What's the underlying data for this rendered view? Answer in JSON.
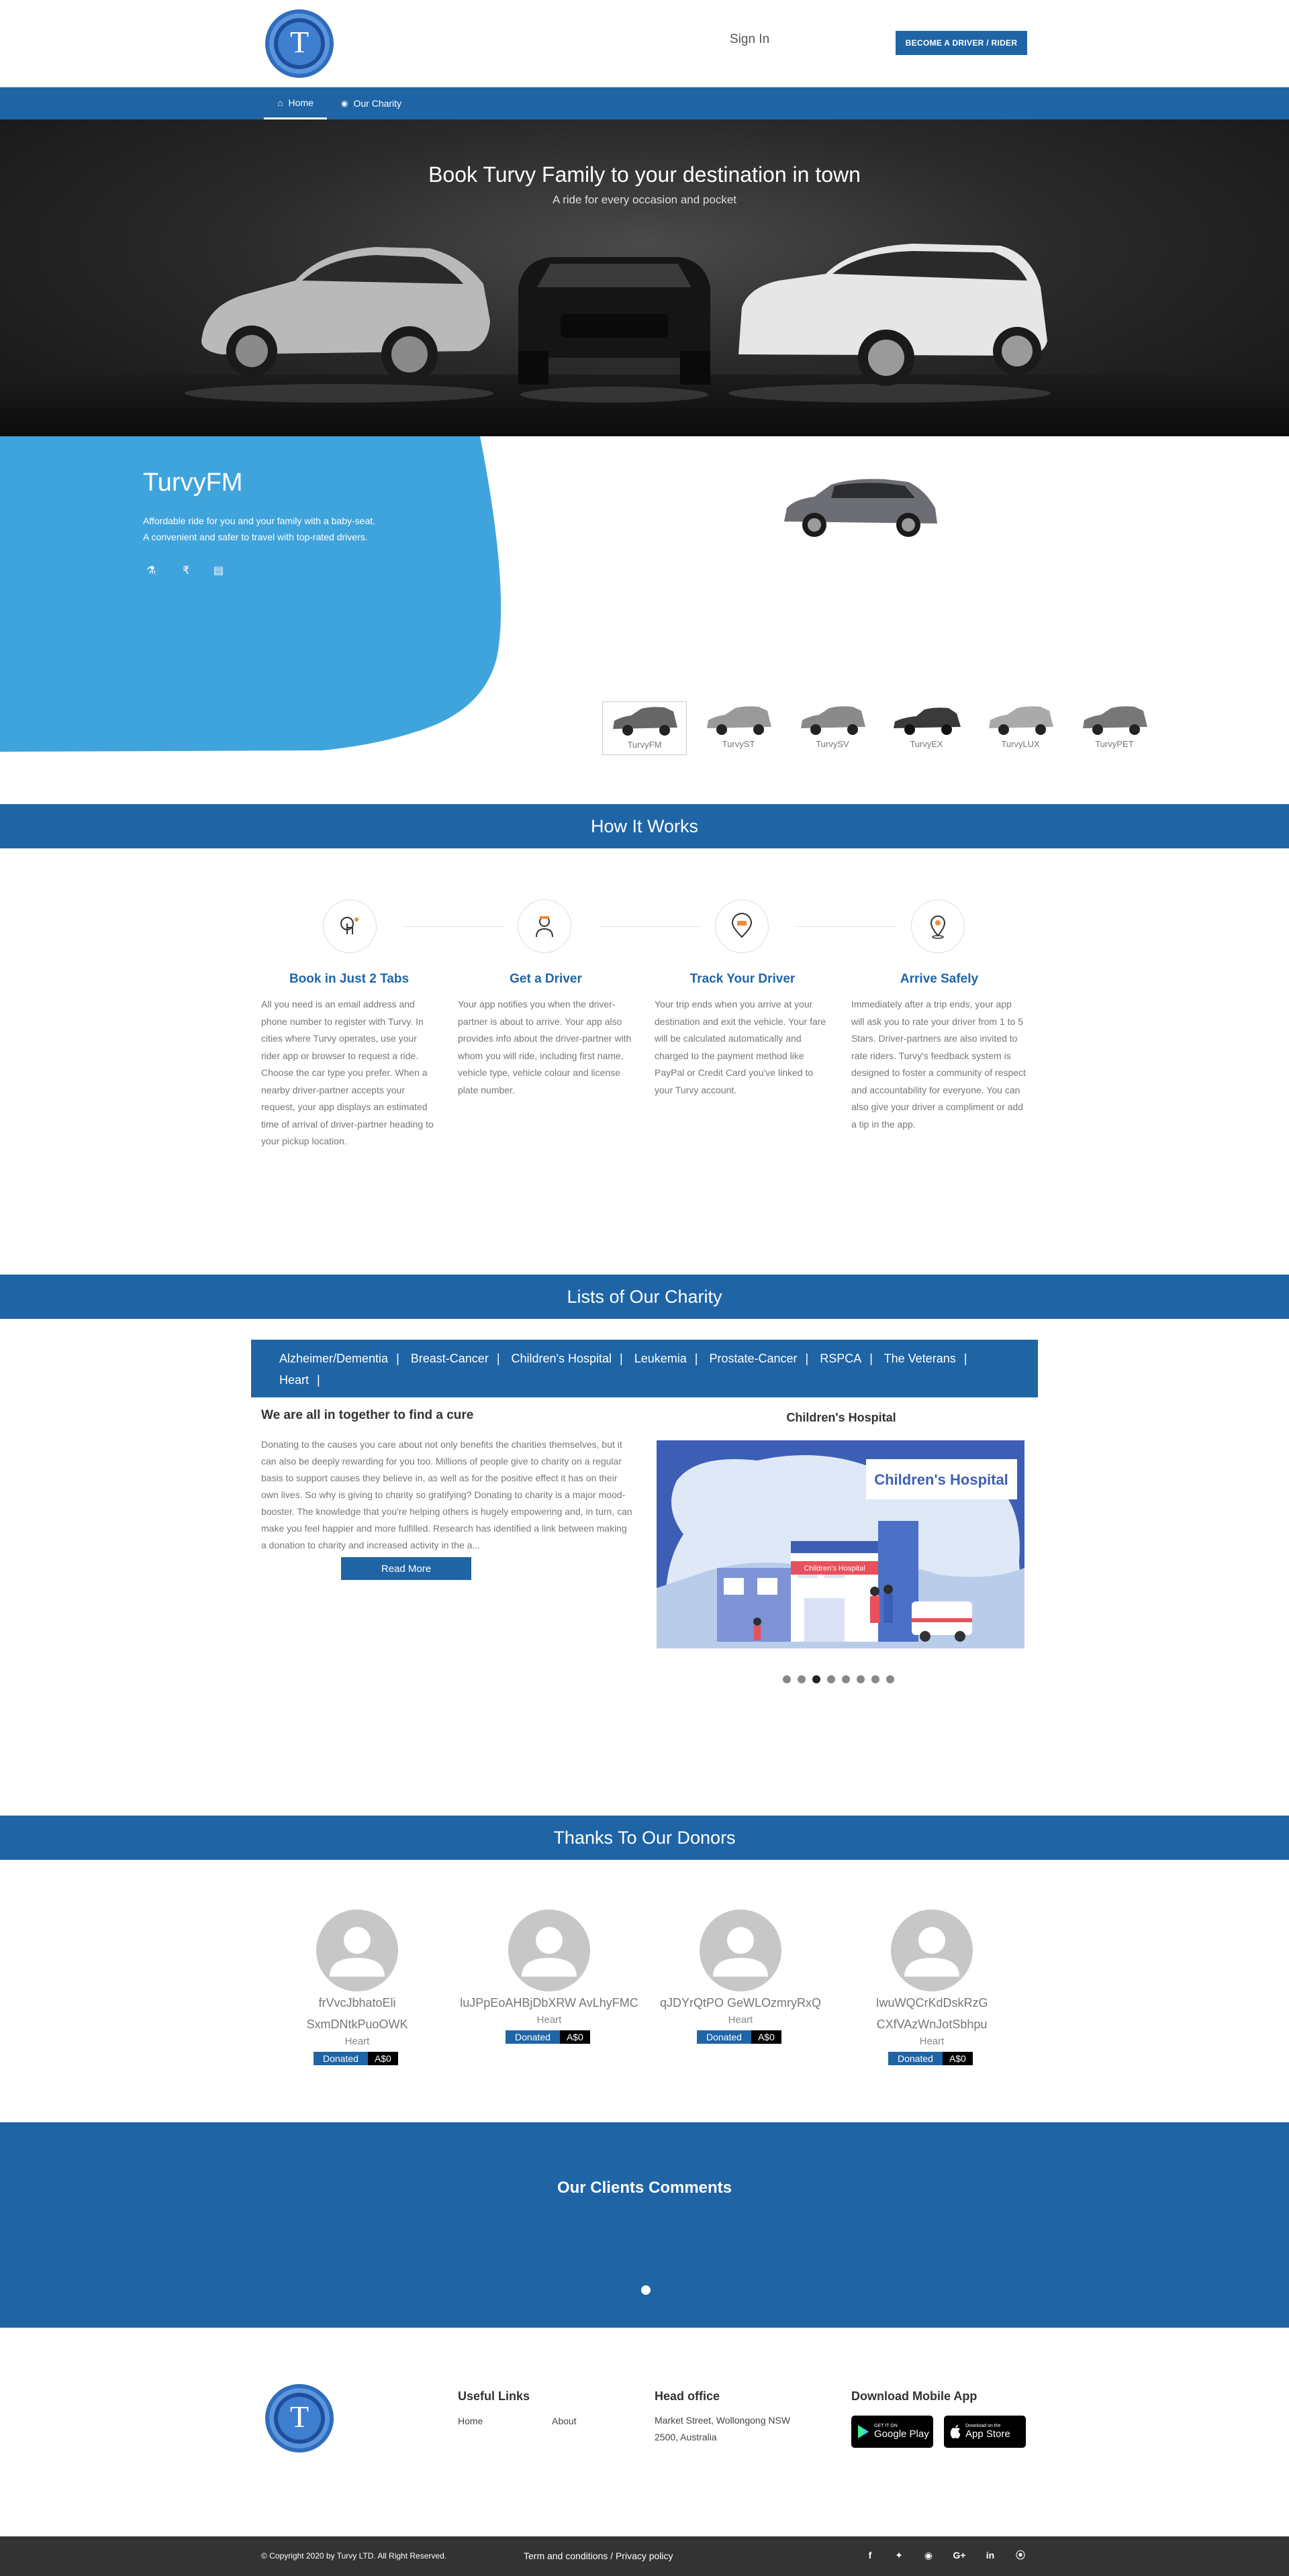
{
  "header": {
    "logo_letter": "T",
    "signin": "Sign In",
    "become_btn": "BECOME A DRIVER / RIDER"
  },
  "nav": {
    "home": "Home",
    "charity": "Our Charity"
  },
  "hero": {
    "title": "Book Turvy Family to your destination in town",
    "subtitle": "A ride for  every occasion and pocket"
  },
  "fm": {
    "title": "TurvyFM",
    "desc1": "Affordable ride for you and your family with a baby-seat.",
    "desc2": "A convenient and safer to travel with top-rated drivers.",
    "cars": [
      "TurvyFM",
      "TurvyST",
      "TurvySV",
      "TurvyEX",
      "TurvyLUX",
      "TurvyPET"
    ]
  },
  "how": {
    "title": "How It Works",
    "steps": [
      {
        "title": "Book in Just 2 Tabs",
        "text": "All you need is an email address and phone number to register with Turvy. In cities where Turvy operates, use your rider app or browser to request a ride. Choose the car type you prefer. When a nearby driver-partner accepts your request, your app displays an estimated time of arrival of driver-partner heading to your pickup location."
      },
      {
        "title": "Get a Driver",
        "text": "Your app notifies you when the driver-partner is about to arrive. Your app also provides info about the driver-partner with whom you will ride, including first name, vehicle type, vehicle colour and license plate number."
      },
      {
        "title": "Track Your Driver",
        "text": "Your trip ends when you arrive at your destination and exit the vehicle. Your fare will be calculated automatically and charged to the payment method like PayPal or Credit Card you've linked to your Turvy account."
      },
      {
        "title": "Arrive Safely",
        "text": "Immediately after a trip ends, your app will ask you to rate your driver from 1 to 5 Stars. Driver-partners are also invited to rate riders. Turvy's feedback system is designed to foster a community of respect and accountability for everyone. You can also give your driver a compliment or add a tip in the app."
      }
    ]
  },
  "charity": {
    "title": "Lists of Our Charity",
    "tabs": [
      "Alzheimer/Dementia",
      "Breast-Cancer",
      "Children's Hospital",
      "Leukemia",
      "Prostate-Cancer",
      "RSPCA",
      "The Veterans",
      "Heart"
    ],
    "heading": "We are all in together to find a cure",
    "text": "Donating to the causes you care about not only benefits the charities themselves, but it can also be deeply rewarding for you too. Millions of people give to charity on a regular basis to support causes they believe in, as well as for the positive effect it has on their own lives. So why is giving to charity so gratifying? Donating to charity is a major mood-booster. The knowledge that you're helping others is hugely empowering and, in turn, can make you feel happier and more fulfilled. Research has identified a link between making a donation to charity and increased activity in the a...",
    "read_more": "Read More",
    "slide_title": "Children's Hospital",
    "slide_banner": "Children's Hospital",
    "slide_sign": "Children's Hospital"
  },
  "donors": {
    "title": "Thanks To Our Donors",
    "list": [
      {
        "name": "frVvcJbhatoEli SxmDNtkPuoOWK",
        "cause": "Heart",
        "donated": "Donated",
        "amount": "A$0"
      },
      {
        "name": "luJPpEoAHBjDbXRW AvLhyFMC",
        "cause": "Heart",
        "donated": "Donated",
        "amount": "A$0"
      },
      {
        "name": "qJDYrQtPO GeWLOzmryRxQ",
        "cause": "Heart",
        "donated": "Donated",
        "amount": "A$0"
      },
      {
        "name": "IwuWQCrKdDskRzG CXfVAzWnJotSbhpu",
        "cause": "Heart",
        "donated": "Donated",
        "amount": "A$0"
      }
    ]
  },
  "comments": {
    "title": "Our Clients Comments"
  },
  "footer": {
    "useful_links": "Useful Links",
    "home": "Home",
    "about": "About",
    "head_office": "Head office",
    "address1": "Market Street, Wollongong NSW",
    "address2": "2500, Australia",
    "download": "Download Mobile App",
    "google_small": "GET IT ON",
    "google_big": "Google Play",
    "apple_small": "Download on the",
    "apple_big": "App Store",
    "copyright": "© Copyright 2020 by Turvy LTD. All Right Reserved.",
    "terms": "Term and conditions / Privacy policy"
  },
  "colors": {
    "primary": "#1f65a6",
    "accent_blue": "#3fa4dc"
  }
}
